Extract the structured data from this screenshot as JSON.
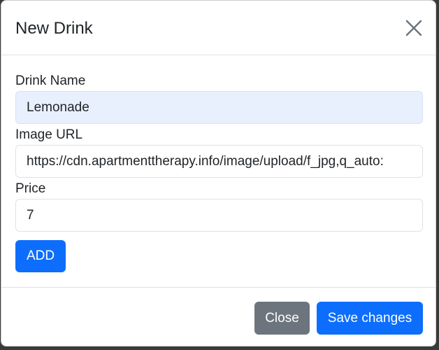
{
  "modal": {
    "title": "New Drink"
  },
  "form": {
    "name_label": "Drink Name",
    "name_value": "Lemonade",
    "image_label": "Image URL",
    "image_value": "https://cdn.apartmenttherapy.info/image/upload/f_jpg,q_auto:",
    "price_label": "Price",
    "price_value": "7",
    "add_label": "ADD"
  },
  "footer": {
    "close_label": "Close",
    "save_label": "Save changes"
  },
  "colors": {
    "primary": "#0d6efd",
    "secondary": "#6c757d",
    "autofill": "#e8f0fe"
  },
  "icons": {
    "close": "close-icon"
  }
}
